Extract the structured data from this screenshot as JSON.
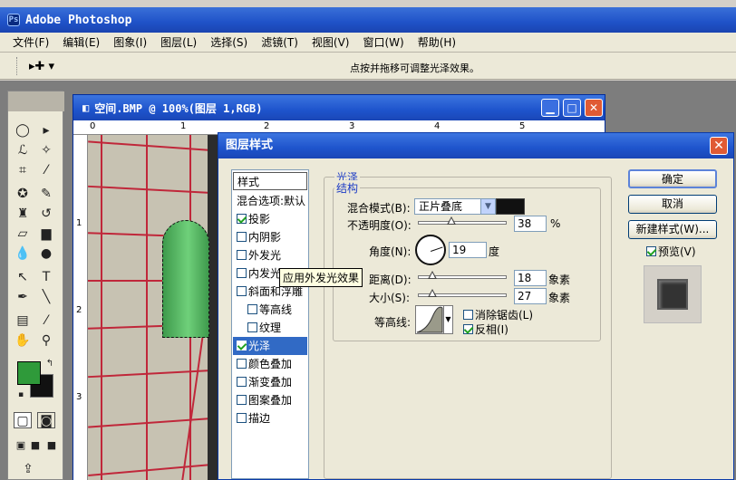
{
  "app": {
    "title": "Adobe Photoshop"
  },
  "menu": [
    "文件(F)",
    "编辑(E)",
    "图象(I)",
    "图层(L)",
    "选择(S)",
    "滤镜(T)",
    "视图(V)",
    "窗口(W)",
    "帮助(H)"
  ],
  "options_bar": {
    "hint": "点按并拖移可调整光泽效果。"
  },
  "document": {
    "title": "空间.BMP @ 100%(图层 1,RGB)",
    "hruler": [
      "0",
      "1",
      "2",
      "3",
      "4",
      "5"
    ],
    "vruler": [
      "1",
      "2",
      "3"
    ]
  },
  "colors": {
    "foreground": "#2f9a3a",
    "background": "#111111",
    "accent": "#1e54cc"
  },
  "dialog": {
    "title": "图层样式",
    "styles_header": "样式",
    "styles": [
      {
        "label": "混合选项:默认",
        "checkbox": false
      },
      {
        "label": "投影",
        "checkbox": true,
        "checked": true
      },
      {
        "label": "内阴影",
        "checkbox": true,
        "checked": false
      },
      {
        "label": "外发光",
        "checkbox": true,
        "checked": false
      },
      {
        "label": "内发光",
        "checkbox": true,
        "checked": false
      },
      {
        "label": "斜面和浮雕",
        "checkbox": true,
        "checked": false
      },
      {
        "label": "等高线",
        "checkbox": true,
        "checked": false
      },
      {
        "label": "纹理",
        "checkbox": true,
        "checked": false
      },
      {
        "label": "光泽",
        "checkbox": true,
        "checked": true,
        "selected": true
      },
      {
        "label": "颜色叠加",
        "checkbox": true,
        "checked": false
      },
      {
        "label": "渐变叠加",
        "checkbox": true,
        "checked": false
      },
      {
        "label": "图案叠加",
        "checkbox": true,
        "checked": false
      },
      {
        "label": "描边",
        "checkbox": true,
        "checked": false
      }
    ],
    "tooltip": "应用外发光效果",
    "satin": {
      "group_title": "光泽",
      "subgroup_title": "结构",
      "blend_mode_label": "混合模式(B):",
      "blend_mode_value": "正片叠底",
      "opacity_label": "不透明度(O):",
      "opacity_value": "38",
      "opacity_unit": "%",
      "angle_label": "角度(N):",
      "angle_value": "19",
      "angle_unit": "度",
      "distance_label": "距离(D):",
      "distance_value": "18",
      "distance_unit": "象素",
      "size_label": "大小(S):",
      "size_value": "27",
      "size_unit": "象素",
      "contour_label": "等高线:",
      "antialias_label": "消除锯齿(L)",
      "antialias_checked": false,
      "invert_label": "反相(I)",
      "invert_checked": true
    },
    "buttons": {
      "ok": "确定",
      "cancel": "取消",
      "new_style": "新建样式(W)...",
      "preview": "预览(V)"
    },
    "preview_checked": true
  }
}
